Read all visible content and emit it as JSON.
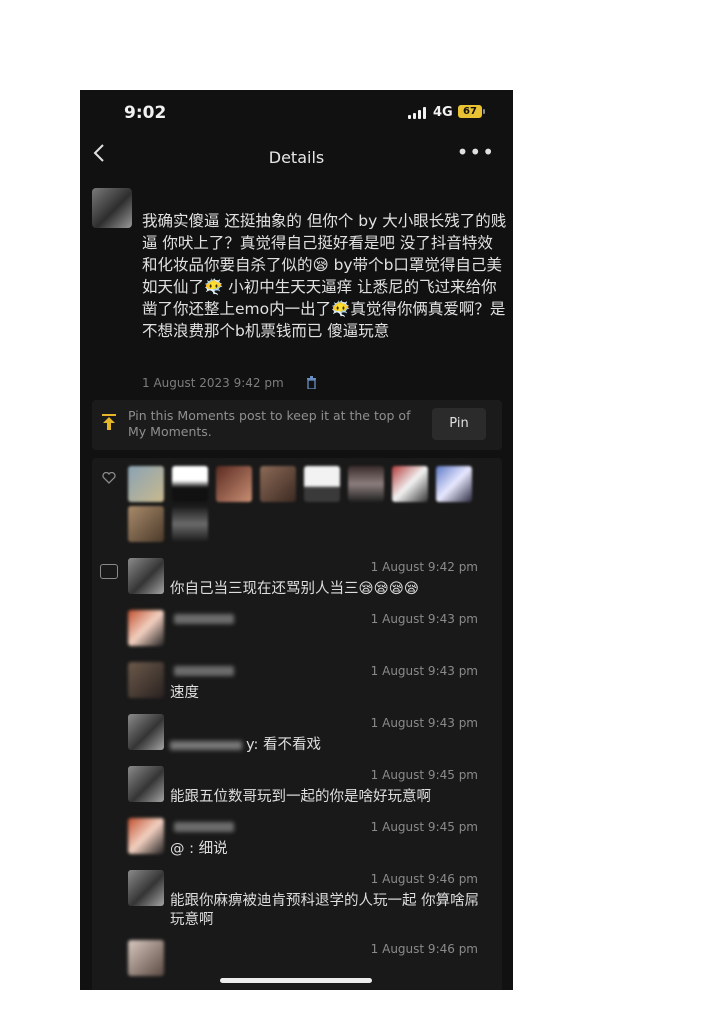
{
  "status_bar": {
    "time": "9:02",
    "network": "4G",
    "battery": "67"
  },
  "nav": {
    "back_icon": "chevron-left-icon",
    "title": "Details",
    "more_icon": "more-dots-icon",
    "more_label": "•••"
  },
  "post": {
    "text": "我确实傻逼 还挺抽象的 但你个 by 大小眼长残了的贱逼 你吠上了？真觉得自己挺好看是吧 没了抖音特效和化妆品你要自杀了似的😪 by带个b口罩觉得自己美如天仙了😶‍🌫️ 小初中生天天逼痒 让悉尼的飞过来给你凿了你还整上emo内一出了😶‍🌫️真觉得你俩真爱啊？是不想浪费那个b机票钱而已 傻逼玩意",
    "timestamp": "1 August 2023 9:42 pm",
    "delete_icon": "trash-icon"
  },
  "pin_banner": {
    "icon": "pin-top-icon",
    "text": "Pin this Moments post to keep it at the top of My Moments.",
    "button_label": "Pin"
  },
  "likes": {
    "icon": "heart-icon"
  },
  "comments": [
    {
      "time": "1 August  9:42 pm",
      "text": "你自己当三现在还骂别人当三😪😪😪😪"
    },
    {
      "time": "1 August  9:43 pm",
      "text": ""
    },
    {
      "time": "1 August  9:43 pm",
      "text": "速度"
    },
    {
      "time": "1 August  9:43 pm",
      "text": "y: 看不看戏"
    },
    {
      "time": "1 August  9:45 pm",
      "text": "能跟五位数哥玩到一起的你是啥好玩意啊"
    },
    {
      "time": "1 August  9:45 pm",
      "text": "@ : 细说"
    },
    {
      "time": "1 August  9:46 pm",
      "text": "能跟你麻痹被迪肯预科退学的人玩一起 你算啥屌玩意啊"
    },
    {
      "time": "1 August  9:46 pm",
      "text": ""
    }
  ],
  "colors": {
    "background": "#111111",
    "panel": "#191919",
    "accent_pin": "#e5b52a",
    "battery": "#e8c233",
    "link_blue": "#6a8fc4"
  }
}
